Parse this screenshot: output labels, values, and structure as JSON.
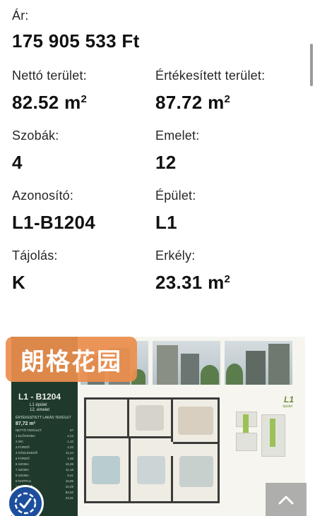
{
  "details": {
    "price": {
      "label": "Ár:",
      "value": "175 905 533 Ft"
    },
    "net_area": {
      "label": "Nettó terület:",
      "value": "82.52 m",
      "unit_sup": "2"
    },
    "sale_area": {
      "label": "Értékesített terület:",
      "value": "87.72 m",
      "unit_sup": "2"
    },
    "rooms": {
      "label": "Szobák:",
      "value": "4"
    },
    "floor": {
      "label": "Emelet:",
      "value": "12"
    },
    "identifier": {
      "label": "Azonosító:",
      "value": "L1-B1204"
    },
    "building": {
      "label": "Épület:",
      "value": "L1"
    },
    "orientation": {
      "label": "Tájolás:",
      "value": "K"
    },
    "balcony": {
      "label": "Erkély:",
      "value": "23.31 m",
      "unit_sup": "2"
    }
  },
  "plan": {
    "unit_title": "L1 - B1204",
    "building_line": "L1 épület",
    "floor_line": "12. emelet",
    "sold_area_label": "ÉRTÉKESÍTETT LAKÁS TERÜLET",
    "sold_area_value": "87,72 m²",
    "keyplan_title": "L1",
    "keyplan_sub": "épület",
    "rooms": [
      {
        "name": "NETTÓ TERÜLET",
        "area": "m²"
      },
      {
        "name": "1  ELŐSZOBA",
        "area": "4,13"
      },
      {
        "name": "2  WC",
        "area": "1,10"
      },
      {
        "name": "3  FÜRDŐ",
        "area": "4,32"
      },
      {
        "name": "4  KÖZLEKEDŐ",
        "area": "11,44"
      },
      {
        "name": "5  FÜRDŐ",
        "area": "4,36"
      },
      {
        "name": "6  SZOBA",
        "area": "10,28"
      },
      {
        "name": "7  SZOBA",
        "area": "11,18"
      },
      {
        "name": "8  SZOBA",
        "area": "9,41"
      },
      {
        "name": "9  NAPPALI",
        "area": "16,85"
      },
      {
        "name": "10 ÉTKEZŐ",
        "area": "10,29"
      },
      {
        "name": "",
        "area": "82,52"
      },
      {
        "name": "",
        "area": "23,31"
      }
    ]
  },
  "overlay": {
    "watermark_badge": "朗格花园"
  }
}
